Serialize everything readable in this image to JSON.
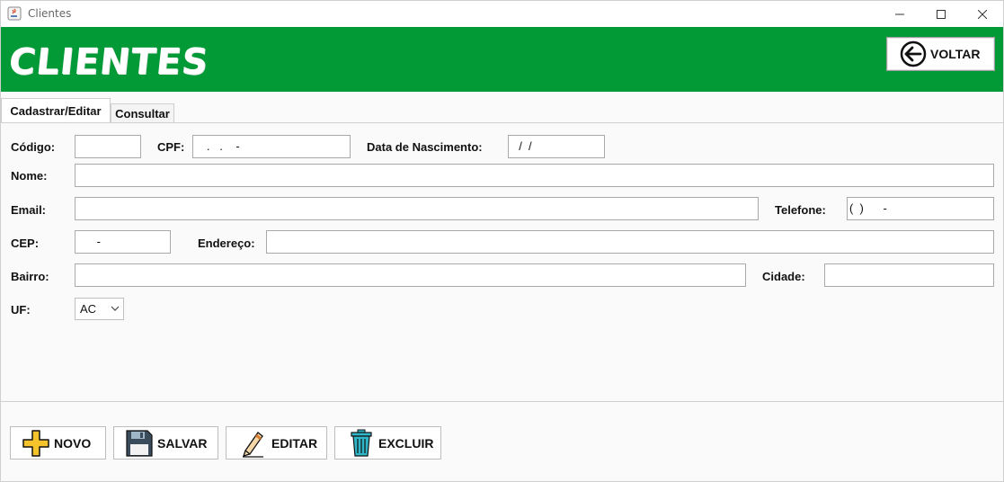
{
  "window": {
    "title": "Clientes"
  },
  "header": {
    "title": "CLIENTES",
    "back_label": "VOLTAR",
    "bg_color": "#029a37"
  },
  "tabs": [
    {
      "label": "Cadastrar/Editar"
    },
    {
      "label": "Consultar"
    }
  ],
  "form": {
    "codigo": {
      "label": "Código:",
      "value": ""
    },
    "cpf": {
      "label": "CPF:",
      "value": "   .   .    -"
    },
    "nascimento": {
      "label": "Data de Nascimento:",
      "value": "  /  /"
    },
    "nome": {
      "label": "Nome:",
      "value": ""
    },
    "email": {
      "label": "Email:",
      "value": ""
    },
    "telefone": {
      "label": "Telefone:",
      "value": "(  )      -"
    },
    "cep": {
      "label": "CEP:",
      "value": "      -"
    },
    "endereco": {
      "label": "Endereço:",
      "value": ""
    },
    "bairro": {
      "label": "Bairro:",
      "value": ""
    },
    "cidade": {
      "label": "Cidade:",
      "value": ""
    },
    "uf": {
      "label": "UF:",
      "value": "AC"
    }
  },
  "actions": {
    "novo": "NOVO",
    "salvar": "SALVAR",
    "editar": "EDITAR",
    "excluir": "EXCLUIR"
  },
  "icons": {
    "app": "java-cup-icon",
    "back": "arrow-left-circle-icon",
    "novo": "plus-icon",
    "salvar": "floppy-disk-icon",
    "editar": "pencil-icon",
    "excluir": "trash-icon"
  }
}
